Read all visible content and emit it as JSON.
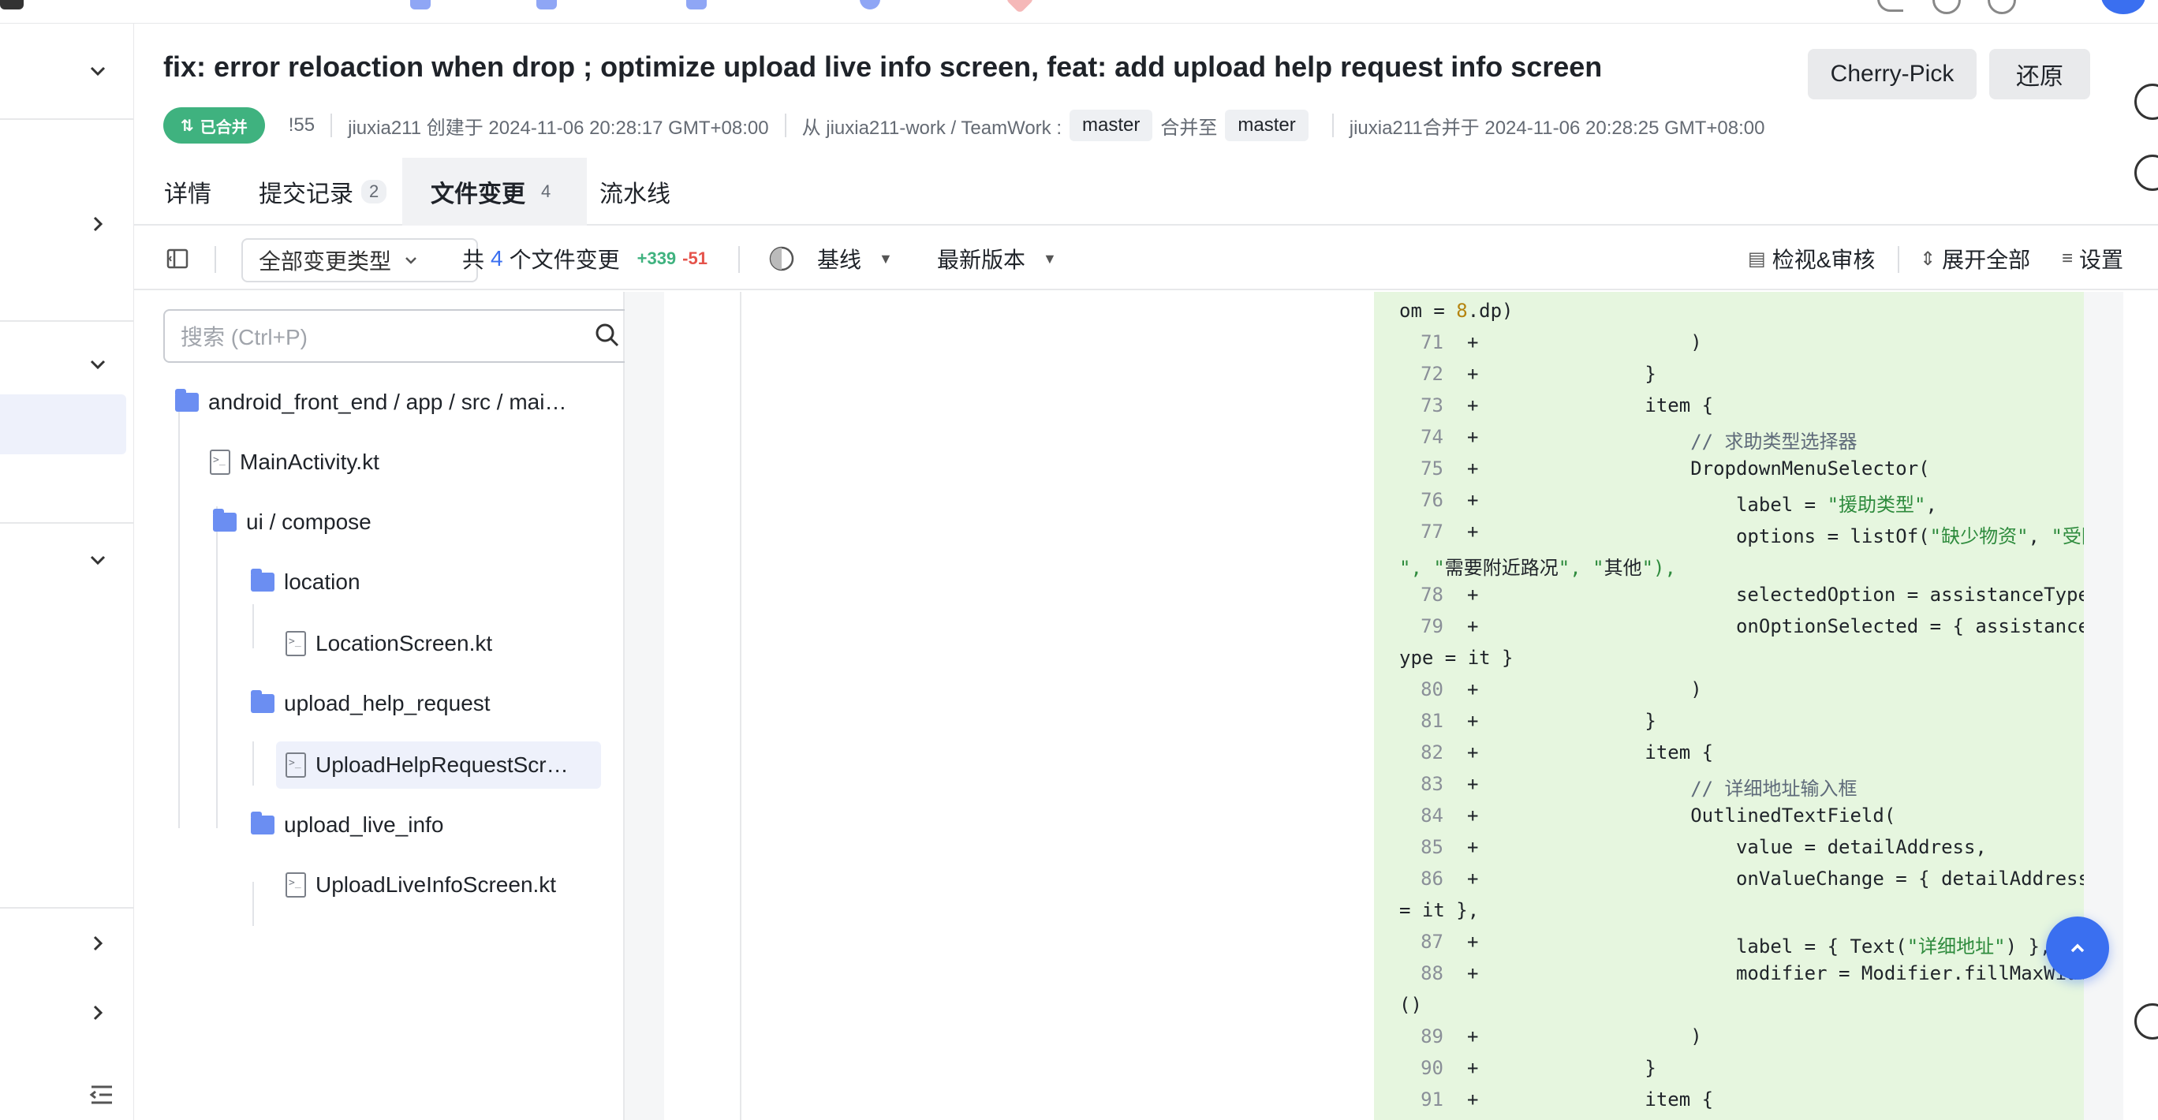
{
  "header": {
    "title": "fix: error reloaction when drop ; optimize upload live info screen, feat: add upload help request info screen",
    "cherry_pick": "Cherry-Pick",
    "revert": "还原"
  },
  "meta": {
    "status": "已合并",
    "id": "!55",
    "created": "jiuxia211 创建于 2024-11-06 20:28:17 GMT+08:00",
    "from": "从 jiuxia211-work / TeamWork :",
    "source_branch": "master",
    "merge_into": "合并至",
    "target_branch": "master",
    "merged": "jiuxia211合并于 2024-11-06 20:28:25 GMT+08:00"
  },
  "tabs": [
    {
      "label": "详情",
      "count": ""
    },
    {
      "label": "提交记录",
      "count": "2"
    },
    {
      "label": "文件变更",
      "count": "4"
    },
    {
      "label": "流水线",
      "count": ""
    }
  ],
  "toolbar": {
    "change_type": "全部变更类型",
    "total_prefix": "共",
    "total_count": "4",
    "total_suffix": "个文件变更",
    "additions": "+339",
    "deletions": "-51",
    "baseline": "基线",
    "latest": "最新版本",
    "review": "检视&审核",
    "expand_all": "展开全部",
    "settings": "设置"
  },
  "filetree": {
    "search_placeholder": "搜索 (Ctrl+P)",
    "items": [
      {
        "name": "android_front_end / app / src / mai…",
        "type": "folder"
      },
      {
        "name": "MainActivity.kt",
        "type": "file"
      },
      {
        "name": "ui / compose",
        "type": "folder"
      },
      {
        "name": "location",
        "type": "folder"
      },
      {
        "name": "LocationScreen.kt",
        "type": "file"
      },
      {
        "name": "upload_help_request",
        "type": "folder"
      },
      {
        "name": "UploadHelpRequestScr…",
        "type": "file"
      },
      {
        "name": "upload_live_info",
        "type": "folder"
      },
      {
        "name": "UploadLiveInfoScreen.kt",
        "type": "file"
      }
    ]
  },
  "diff": {
    "lines": [
      {
        "n": "",
        "plus": "",
        "text": "om = 8.dp)"
      },
      {
        "n": "71",
        "plus": "+",
        "text": "                )"
      },
      {
        "n": "72",
        "plus": "+",
        "text": "            }"
      },
      {
        "n": "73",
        "plus": "+",
        "text": "            item {"
      },
      {
        "n": "74",
        "plus": "+",
        "text": "                // 求助类型选择器"
      },
      {
        "n": "75",
        "plus": "+",
        "text": "                DropdownMenuSelector("
      },
      {
        "n": "76",
        "plus": "+",
        "text": "                    label = \"援助类型\","
      },
      {
        "n": "77",
        "plus": "+",
        "text": "                    options = listOf(\"缺少物资\", \"受困"
      },
      {
        "n": "",
        "plus": "",
        "text": "\", \"需要附近路况\", \"其他\"),"
      },
      {
        "n": "78",
        "plus": "+",
        "text": "                    selectedOption = assistanceType,"
      },
      {
        "n": "79",
        "plus": "+",
        "text": "                    onOptionSelected = { assistanceT"
      },
      {
        "n": "",
        "plus": "",
        "text": "ype = it }"
      },
      {
        "n": "80",
        "plus": "+",
        "text": "                )"
      },
      {
        "n": "81",
        "plus": "+",
        "text": "            }"
      },
      {
        "n": "82",
        "plus": "+",
        "text": "            item {"
      },
      {
        "n": "83",
        "plus": "+",
        "text": "                // 详细地址输入框"
      },
      {
        "n": "84",
        "plus": "+",
        "text": "                OutlinedTextField("
      },
      {
        "n": "85",
        "plus": "+",
        "text": "                    value = detailAddress,"
      },
      {
        "n": "86",
        "plus": "+",
        "text": "                    onValueChange = { detailAddress"
      },
      {
        "n": "",
        "plus": "",
        "text": "= it },"
      },
      {
        "n": "87",
        "plus": "+",
        "text": "                    label = { Text(\"详细地址\") },"
      },
      {
        "n": "88",
        "plus": "+",
        "text": "                    modifier = Modifier.fillMaxWidth"
      },
      {
        "n": "",
        "plus": "",
        "text": "()"
      },
      {
        "n": "89",
        "plus": "+",
        "text": "                )"
      },
      {
        "n": "90",
        "plus": "+",
        "text": "            }"
      },
      {
        "n": "91",
        "plus": "+",
        "text": "            item {"
      }
    ]
  },
  "colors": {
    "accent": "#3a6ff0",
    "merged": "#3fb27f",
    "addition_bg": "#e6f6df",
    "deletion": "#e5534b"
  }
}
